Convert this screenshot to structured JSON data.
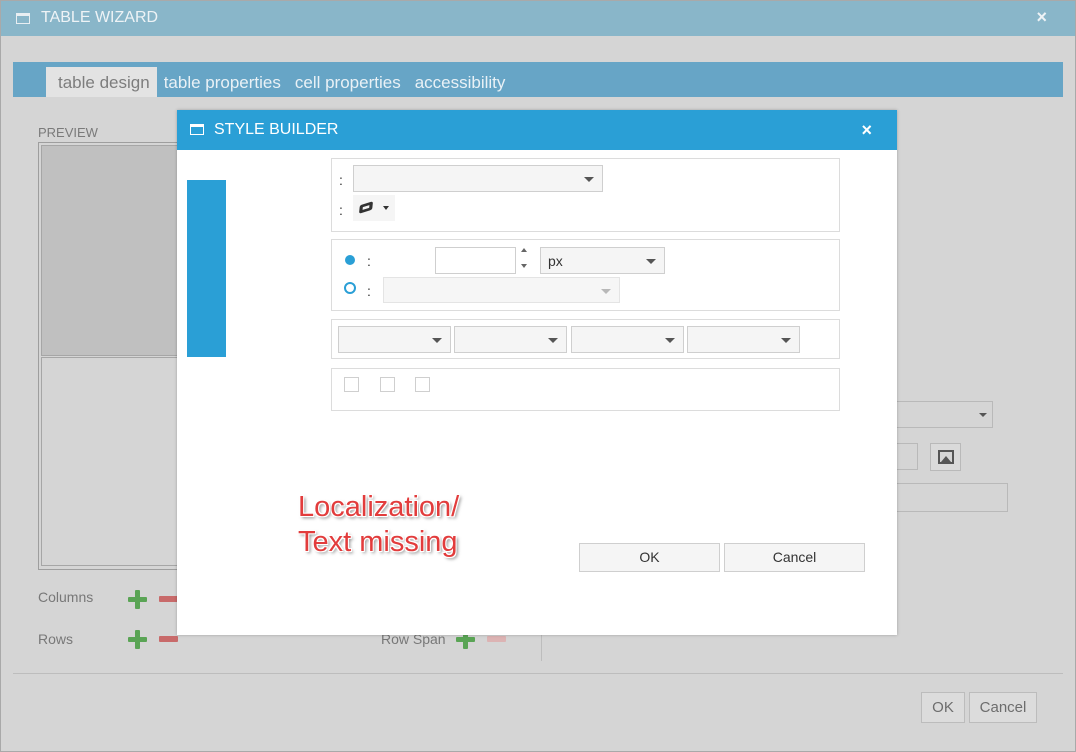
{
  "wizard": {
    "title": "TABLE WIZARD",
    "close_label": "×",
    "tabs": [
      {
        "label": "table design",
        "active": true
      },
      {
        "label": "table properties",
        "active": false
      },
      {
        "label": "cell properties",
        "active": false
      },
      {
        "label": "accessibility",
        "active": false
      }
    ],
    "preview_label": "PREVIEW",
    "columns_label": "Columns",
    "rows_label": "Rows",
    "row_span_label": "Row Span",
    "ok_label": "OK",
    "cancel_label": "Cancel"
  },
  "style_builder": {
    "title": "STYLE BUILDER",
    "close_label": "×",
    "colon": ":",
    "size_unit": "px",
    "ok_label": "OK",
    "cancel_label": "Cancel"
  },
  "annotation": {
    "line1": "Localization/",
    "line2": "Text missing"
  },
  "colors": {
    "style_builder_accent": "#2a9fd6",
    "wizard_tabbar": "#67a5c6",
    "annotation": "#e23c3c"
  }
}
